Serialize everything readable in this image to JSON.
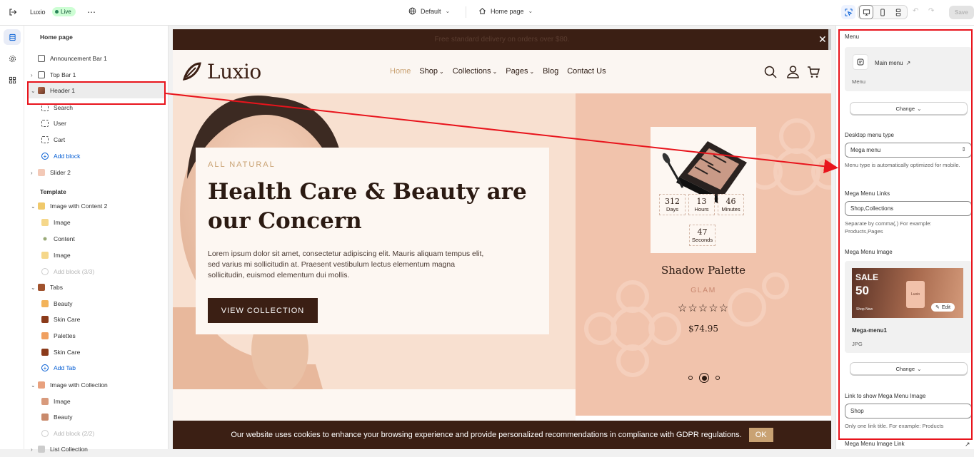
{
  "topbar": {
    "store_name": "Luxio",
    "live_badge": "Live",
    "theme_selector": "Default",
    "page_selector": "Home page",
    "save_label": "Save"
  },
  "sidebar": {
    "page_title": "Home page",
    "header_items": [
      {
        "label": "Announcement Bar 1",
        "icon": "announcement-icon"
      },
      {
        "label": "Top Bar 1",
        "icon": "topbar-icon"
      },
      {
        "label": "Header 1",
        "icon": "header-icon"
      },
      {
        "label": "Search",
        "icon": "block-icon"
      },
      {
        "label": "User",
        "icon": "block-icon"
      },
      {
        "label": "Cart",
        "icon": "block-icon"
      },
      {
        "label": "Add block",
        "icon": "plus-circle-icon"
      },
      {
        "label": "Slider 2",
        "icon": "slider-icon"
      }
    ],
    "template_title": "Template",
    "template_items": [
      {
        "label": "Image with Content 2"
      },
      {
        "label": "Image"
      },
      {
        "label": "Content"
      },
      {
        "label": "Image"
      },
      {
        "label": "Add block (3/3)"
      },
      {
        "label": "Tabs"
      },
      {
        "label": "Beauty"
      },
      {
        "label": "Skin Care"
      },
      {
        "label": "Palettes"
      },
      {
        "label": "Skin Care"
      },
      {
        "label": "Add Tab"
      },
      {
        "label": "Image with Collection"
      },
      {
        "label": "Image"
      },
      {
        "label": "Beauty"
      },
      {
        "label": "Add block (2/2)"
      },
      {
        "label": "List Collection"
      }
    ]
  },
  "preview": {
    "announcement": "Free standard delivery on orders over $80.",
    "logo": "Luxio",
    "nav": [
      "Home",
      "Shop",
      "Collections",
      "Pages",
      "Blog",
      "Contact Us"
    ],
    "hero": {
      "eyebrow": "ALL NATURAL",
      "title_line1": "Health Care & Beauty are",
      "title_line2": "our Concern",
      "body": "Lorem ipsum dolor sit amet, consectetur adipiscing elit. Mauris aliquam tempus elit, sed varius mi sollicitudin at. Praesent vestibulum lectus elementum magna sollicitudin, euismod elementum dui mollis.",
      "cta": "VIEW COLLECTION"
    },
    "product": {
      "countdown": [
        {
          "value": "312",
          "unit": "Days"
        },
        {
          "value": "13",
          "unit": "Hours"
        },
        {
          "value": "46",
          "unit": "Minutes"
        },
        {
          "value": "47",
          "unit": "Seconds"
        }
      ],
      "name": "Shadow Palette",
      "vendor": "GLAM",
      "stars": "☆☆☆☆☆",
      "price": "$74.95"
    },
    "cookie": {
      "text": "Our website uses cookies to enhance your browsing experience and provide personalized recommendations in compliance with GDPR regulations.",
      "ok": "OK"
    }
  },
  "settings": {
    "menu_label": "Menu",
    "menu_name": "Main menu",
    "menu_sub": "Menu",
    "change": "Change",
    "desktop_menu_type_label": "Desktop menu type",
    "desktop_menu_type_value": "Mega menu",
    "desktop_menu_type_help": "Menu type is automatically optimized for mobile.",
    "mega_links_label": "Mega Menu Links",
    "mega_links_value": "Shop,Collections",
    "mega_links_help": "Separate by comma(,) For example: Products,Pages",
    "mega_image_label": "Mega Menu Image",
    "mega_image_name": "Mega-menu1",
    "mega_image_type": "JPG",
    "edit": "Edit",
    "promo_sale": "SALE",
    "promo_pct": "50",
    "promo_shop": "Shop Now",
    "promo_brand": "Luxio",
    "link_show_label": "Link to show Mega Menu Image",
    "link_show_value": "Shop",
    "link_show_help": "Only one link title. For example: Products",
    "mega_image_link_label": "Mega Menu Image Link"
  },
  "colors": {
    "accent_red": "#e8141c",
    "brand_dark": "#3b1f14",
    "hero_bg": "#f7dcc8",
    "product_bg": "#f1c3ac",
    "link_blue": "#005bd3"
  }
}
